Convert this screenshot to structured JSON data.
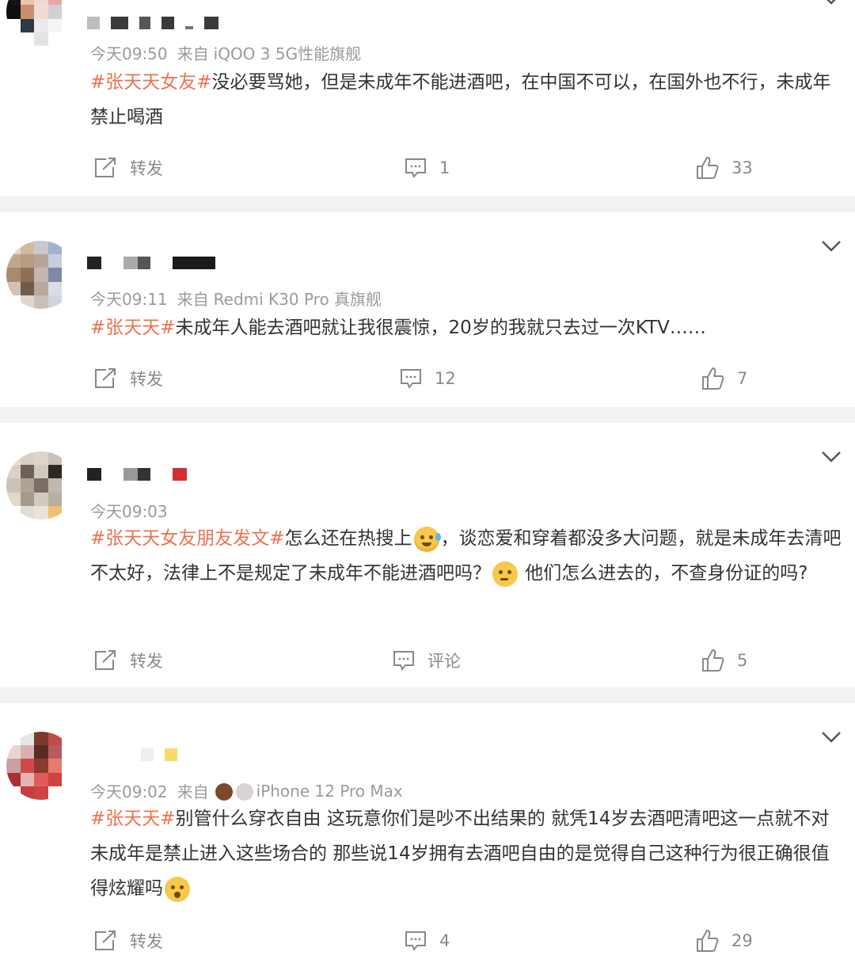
{
  "posts": [
    {
      "time": "今天09:50",
      "from_label": "来自",
      "device": "iQOO 3 5G性能旗舰",
      "topic": "#张天天女友#",
      "text": "没必要骂她，但是未成年不能进酒吧，在中国不可以，在国外也不行，未成年禁止喝酒",
      "repost_label": "转发",
      "comment_label": "1",
      "like_count": "33"
    },
    {
      "time": "今天09:11",
      "from_label": "来自",
      "device": "Redmi K30 Pro 真旗舰",
      "topic": "#张天天#",
      "text": "未成年人能去酒吧就让我很震惊，20岁的我就只去过一次KTV……",
      "repost_label": "转发",
      "comment_label": "12",
      "like_count": "7"
    },
    {
      "time": "今天09:03",
      "topic": "#张天天女友朋友发文#",
      "text_a": "怎么还在热搜上",
      "text_b": "，谈恋爱和穿着都没多大问题，就是未成年去清吧不太好，法律上不是规定了未成年不能进酒吧吗？",
      "text_c": " 他们怎么进去的，不查身份证的吗?",
      "repost_label": "转发",
      "comment_label": "评论",
      "like_count": "5"
    },
    {
      "time": "今天09:02",
      "from_label": "来自",
      "device": "iPhone 12 Pro Max",
      "topic": "#张天天#",
      "text": "别管什么穿衣自由 这玩意你们是吵不出结果的 就凭14岁去酒吧清吧这一点就不对 未成年是禁止进入这些场合的 那些说14岁拥有去酒吧自由的是觉得自己这种行为很正确很值得炫耀吗",
      "repost_label": "转发",
      "comment_label": "4",
      "like_count": "29"
    }
  ],
  "colors": {
    "topic": "#eb7350",
    "meta": "#9a9a9a",
    "separator": "#f2f2f2"
  }
}
